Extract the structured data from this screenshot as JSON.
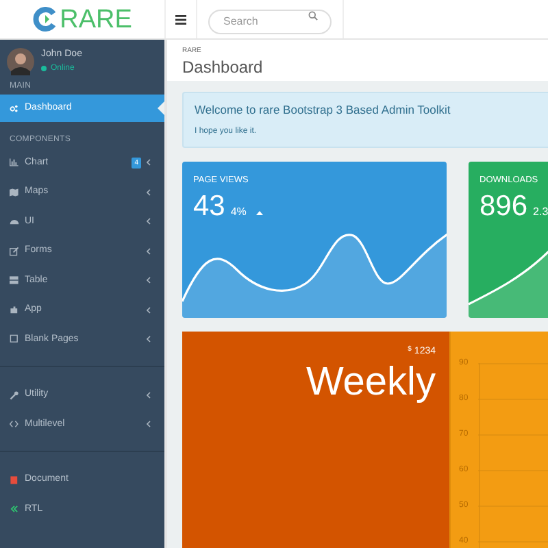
{
  "logo": {
    "text": "RARE"
  },
  "search": {
    "placeholder": "Search"
  },
  "user": {
    "name": "John Doe",
    "status": "Online"
  },
  "sidebar": {
    "sections": [
      {
        "heading": "MAIN",
        "items": [
          {
            "label": "Dashboard",
            "kind": "cogs",
            "selected": true
          }
        ]
      },
      {
        "heading": "COMPONENTS",
        "items": [
          {
            "label": "Chart",
            "kind": "chart",
            "badge": "4",
            "selected": false,
            "expandable": true
          },
          {
            "label": "Maps",
            "kind": "map",
            "selected": false,
            "expandable": true
          },
          {
            "label": "UI",
            "kind": "gauge",
            "selected": false,
            "expandable": true
          },
          {
            "label": "Forms",
            "kind": "edit",
            "selected": false,
            "expandable": true
          },
          {
            "label": "Table",
            "kind": "table",
            "selected": false,
            "expandable": true
          },
          {
            "label": "App",
            "kind": "puzzle",
            "selected": false,
            "expandable": true
          },
          {
            "label": "Blank Pages",
            "kind": "square",
            "selected": false,
            "expandable": true
          }
        ]
      },
      {
        "items": [
          {
            "label": "Utility",
            "kind": "wrench",
            "selected": false,
            "expandable": true
          },
          {
            "label": "Multilevel",
            "kind": "code",
            "selected": false,
            "expandable": true
          }
        ]
      },
      {
        "items": [
          {
            "label": "Document",
            "kind": "book",
            "selected": false
          },
          {
            "label": "RTL",
            "kind": "angles",
            "selected": false
          }
        ]
      }
    ]
  },
  "breadcrumb": "RARE",
  "page_title": "Dashboard",
  "alert": {
    "title": "Welcome to rare Bootstrap 3 Based Admin Toolkit",
    "text": "I hope you like it."
  },
  "stat_cards": [
    {
      "title": "PAGE VIEWS",
      "value": "43",
      "change": "4%",
      "color": "#3498db"
    },
    {
      "title": "DOWNLOADS",
      "value": "896",
      "change": "2.3",
      "color": "#27ae60"
    }
  ],
  "weekly": {
    "amount_symbol": "$",
    "amount": "1234",
    "label": "Weekly"
  },
  "chart_axis": {
    "labels": [
      "90",
      "80",
      "70",
      "60",
      "50",
      "40"
    ]
  }
}
